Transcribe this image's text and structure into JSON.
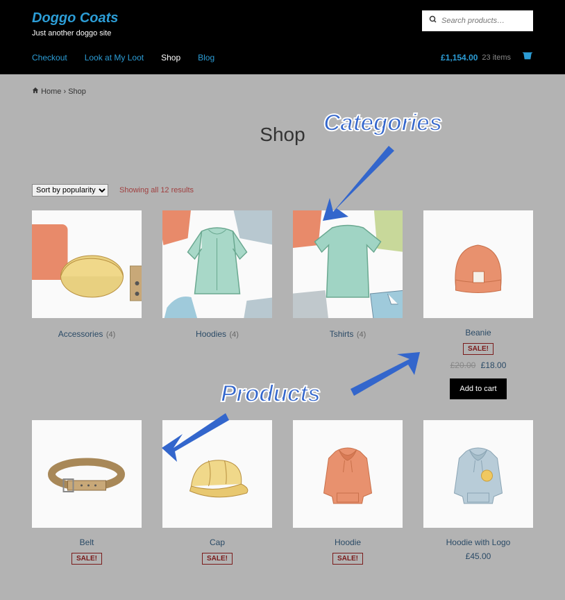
{
  "header": {
    "title": "Doggo Coats",
    "tagline": "Just another doggo site",
    "search_placeholder": "Search products…"
  },
  "nav": {
    "items": [
      {
        "label": "Checkout",
        "active": false
      },
      {
        "label": "Look at My Loot",
        "active": false
      },
      {
        "label": "Shop",
        "active": true
      },
      {
        "label": "Blog",
        "active": false
      }
    ]
  },
  "cart": {
    "total": "£1,154.00",
    "items": "23 items"
  },
  "breadcrumb": {
    "home": "Home",
    "current": "Shop"
  },
  "page": {
    "title": "Shop",
    "sort_label": "Sort by popularity",
    "result_count": "Showing all 12 results"
  },
  "annotations": {
    "categories": "Categories",
    "products": "Products"
  },
  "categories": [
    {
      "name": "Accessories",
      "count": "(4)"
    },
    {
      "name": "Hoodies",
      "count": "(4)"
    },
    {
      "name": "Tshirts",
      "count": "(4)"
    }
  ],
  "products": [
    {
      "name": "Beanie",
      "sale": "SALE!",
      "old_price": "£20.00",
      "price": "£18.00",
      "add": "Add to cart"
    },
    {
      "name": "Belt",
      "sale": "SALE!"
    },
    {
      "name": "Cap",
      "sale": "SALE!"
    },
    {
      "name": "Hoodie",
      "sale": "SALE!"
    },
    {
      "name": "Hoodie with Logo",
      "price": "£45.00"
    }
  ]
}
